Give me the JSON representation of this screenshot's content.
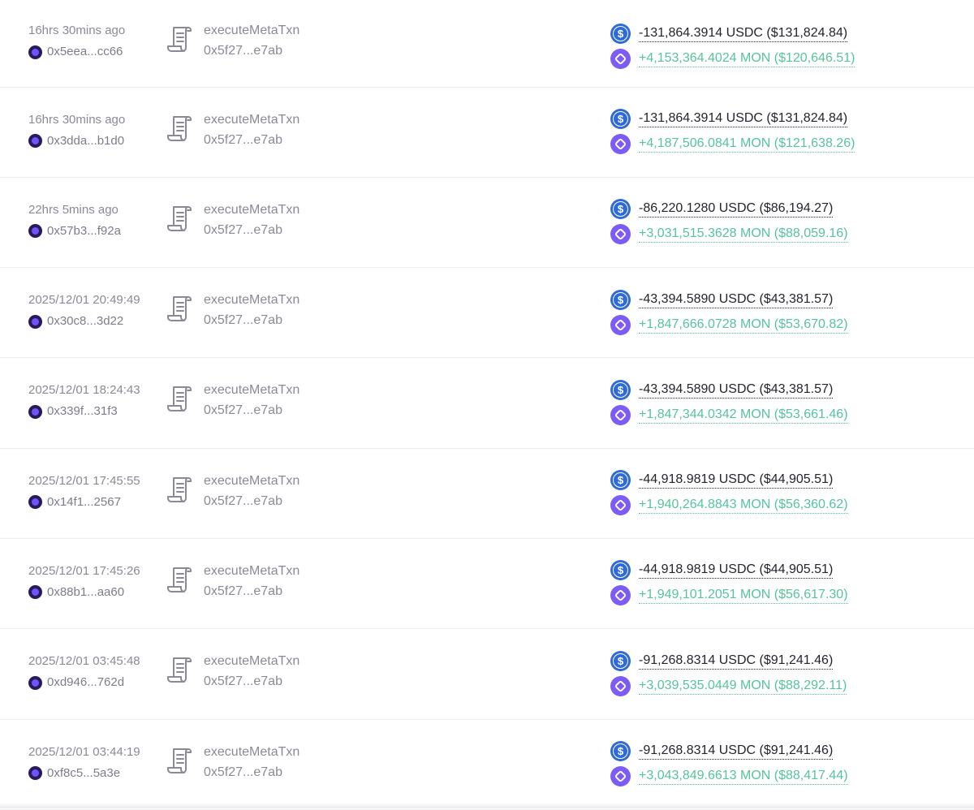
{
  "transactions": [
    {
      "time": "16hrs 30mins ago",
      "sender": "0x5eea...cc66",
      "method": "executeMetaTxn",
      "contract": "0x5f27...e7ab",
      "out": "-131,864.3914 USDC ($131,824.84)",
      "in": "+4,153,364.4024 MON ($120,646.51)"
    },
    {
      "time": "16hrs 30mins ago",
      "sender": "0x3dda...b1d0",
      "method": "executeMetaTxn",
      "contract": "0x5f27...e7ab",
      "out": "-131,864.3914 USDC ($131,824.84)",
      "in": "+4,187,506.0841 MON ($121,638.26)"
    },
    {
      "time": "22hrs 5mins ago",
      "sender": "0x57b3...f92a",
      "method": "executeMetaTxn",
      "contract": "0x5f27...e7ab",
      "out": "-86,220.1280 USDC ($86,194.27)",
      "in": "+3,031,515.3628 MON ($88,059.16)"
    },
    {
      "time": "2025/12/01 20:49:49",
      "sender": "0x30c8...3d22",
      "method": "executeMetaTxn",
      "contract": "0x5f27...e7ab",
      "out": "-43,394.5890 USDC ($43,381.57)",
      "in": "+1,847,666.0728 MON ($53,670.82)"
    },
    {
      "time": "2025/12/01 18:24:43",
      "sender": "0x339f...31f3",
      "method": "executeMetaTxn",
      "contract": "0x5f27...e7ab",
      "out": "-43,394.5890 USDC ($43,381.57)",
      "in": "+1,847,344.0342 MON ($53,661.46)"
    },
    {
      "time": "2025/12/01 17:45:55",
      "sender": "0x14f1...2567",
      "method": "executeMetaTxn",
      "contract": "0x5f27...e7ab",
      "out": "-44,918.9819 USDC ($44,905.51)",
      "in": "+1,940,264.8843 MON ($56,360.62)"
    },
    {
      "time": "2025/12/01 17:45:26",
      "sender": "0x88b1...aa60",
      "method": "executeMetaTxn",
      "contract": "0x5f27...e7ab",
      "out": "-44,918.9819 USDC ($44,905.51)",
      "in": "+1,949,101.2051 MON ($56,617.30)"
    },
    {
      "time": "2025/12/01 03:45:48",
      "sender": "0xd946...762d",
      "method": "executeMetaTxn",
      "contract": "0x5f27...e7ab",
      "out": "-91,268.8314 USDC ($91,241.46)",
      "in": "+3,039,535.0449 MON ($88,292.11)"
    },
    {
      "time": "2025/12/01 03:44:19",
      "sender": "0xf8c5...5a3e",
      "method": "executeMetaTxn",
      "contract": "0x5f27...e7ab",
      "out": "-91,268.8314 USDC ($91,241.46)",
      "in": "+3,043,849.6613 MON ($88,417.44)"
    }
  ],
  "icons": {
    "method": "scroll-icon",
    "sender": "address-avatar-icon",
    "token_out": "usdc-token-icon",
    "token_in": "mon-token-icon"
  },
  "colors": {
    "outgoing": "#24242e",
    "incoming": "#56c49a",
    "usdc": "#2f6ad9",
    "mon": "#7c5cf5",
    "muted_text": "#8a8a96"
  }
}
